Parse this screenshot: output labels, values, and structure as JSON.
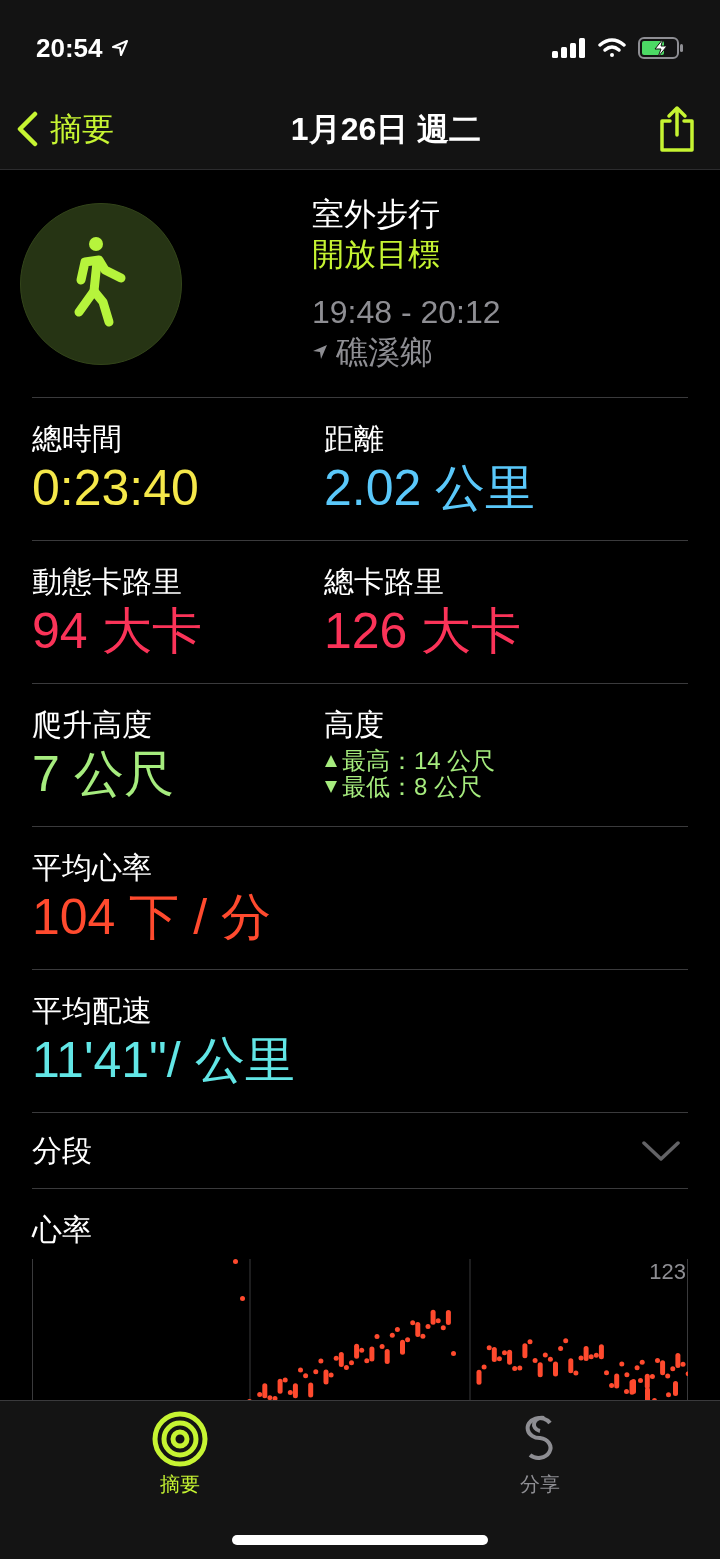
{
  "status_bar": {
    "time": "20:54"
  },
  "nav": {
    "back_label": "摘要",
    "title": "1月26日 週二"
  },
  "workout": {
    "name": "室外步行",
    "goal": "開放目標",
    "time_range": "19:48 - 20:12",
    "location": "礁溪鄉"
  },
  "metrics": [
    {
      "cells": [
        {
          "kind": "value",
          "label": "總時間",
          "value": "0:23:40",
          "color": "#f5e84a"
        },
        {
          "kind": "value",
          "label": "距離",
          "value": "2.02 公里",
          "color": "#5ac8fa"
        }
      ]
    },
    {
      "cells": [
        {
          "kind": "value",
          "label": "動態卡路里",
          "value": "94 大卡",
          "color": "#fa3358"
        },
        {
          "kind": "value",
          "label": "總卡路里",
          "value": "126 大卡",
          "color": "#fa3358"
        }
      ]
    },
    {
      "cells": [
        {
          "kind": "value",
          "label": "爬升高度",
          "value": "7 公尺",
          "color": "#a6ec7e"
        },
        {
          "kind": "range",
          "label": "高度",
          "color": "#a6ec7e",
          "lines": [
            {
              "kind": "up",
              "text": "最高：14 公尺"
            },
            {
              "kind": "down",
              "text": "最低：8 公尺"
            }
          ]
        }
      ]
    },
    {
      "cells": [
        {
          "kind": "value",
          "label": "平均心率",
          "value": "104 下 / 分",
          "color": "#ff4a2e"
        }
      ]
    },
    {
      "cells": [
        {
          "kind": "value",
          "label": "平均配速",
          "value": "11'41\"/ 公里",
          "color": "#62e6e6"
        }
      ]
    }
  ],
  "segments": {
    "label": "分段",
    "expanded": false
  },
  "heart_rate": {
    "title": "心率",
    "max_label": "123"
  },
  "tab_bar": [
    {
      "label": "摘要",
      "selected": true
    },
    {
      "label": "分享",
      "selected": false
    }
  ]
}
